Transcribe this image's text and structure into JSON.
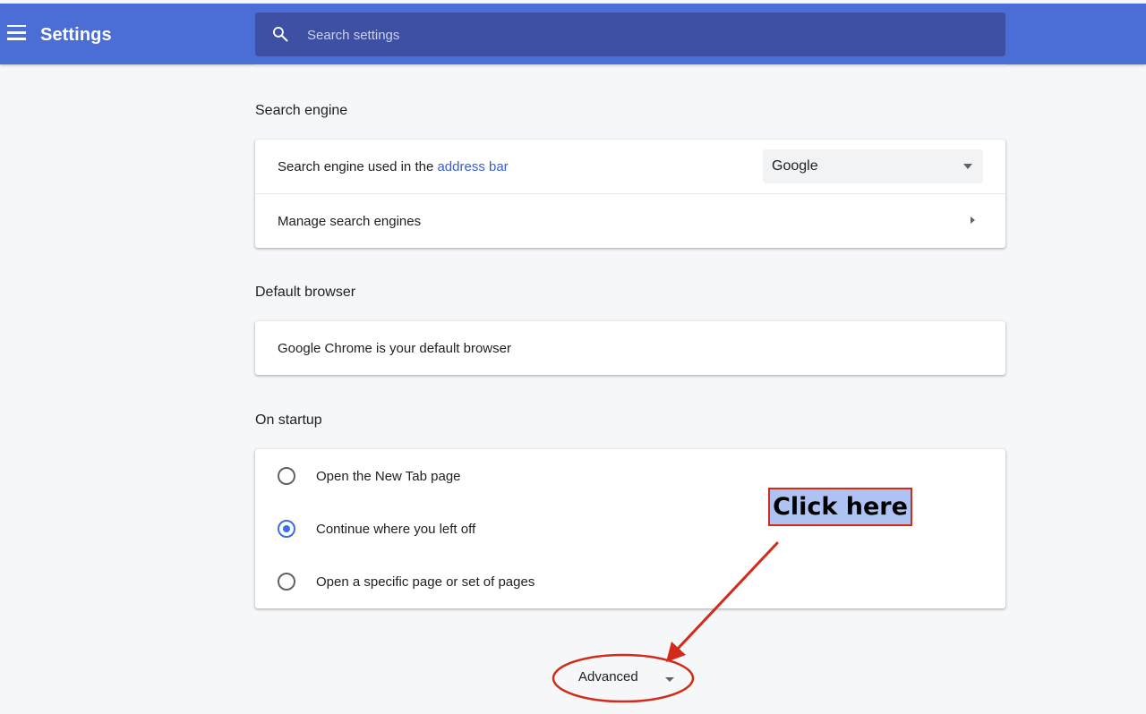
{
  "header": {
    "title": "Settings",
    "menu_icon": "hamburger-menu-icon",
    "accent": "#4a6dd6"
  },
  "search": {
    "placeholder": "Search settings",
    "value": "",
    "icon": "search-icon",
    "background": "#3d50a3"
  },
  "search_engine": {
    "title": "Search engine",
    "used_in_prefix": "Search engine used in the ",
    "used_in_link": "address bar",
    "selected_engine": "Google",
    "manage_label": "Manage search engines"
  },
  "default_browser": {
    "title": "Default browser",
    "status": "Google Chrome is your default browser"
  },
  "startup": {
    "title": "On startup",
    "options": [
      {
        "label": "Open the New Tab page",
        "checked": false
      },
      {
        "label": "Continue where you left off",
        "checked": true
      },
      {
        "label": "Open a specific page or set of pages",
        "checked": false
      }
    ],
    "radio_accent": "#3a6fe0"
  },
  "advanced": {
    "label": "Advanced"
  },
  "annotation": {
    "callout_text": "Click here",
    "callout_bg": "#aec3f3",
    "annotation_color": "#d42a1a"
  }
}
